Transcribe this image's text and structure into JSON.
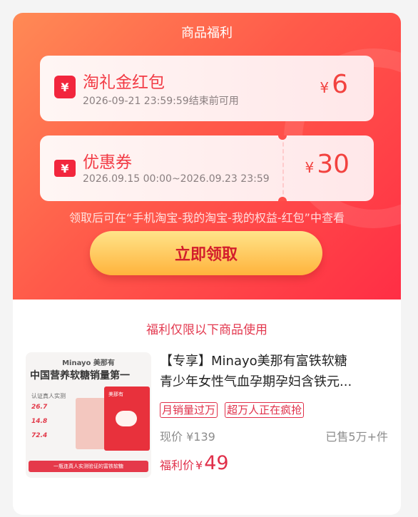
{
  "header": {
    "title": "商品福利"
  },
  "coupons": [
    {
      "icon": "red-envelope-icon",
      "icon_glyph": "¥",
      "title": "淘礼金红包",
      "validity": "2026-09-21 23:59:59结束前可用",
      "currency": "¥",
      "amount": "6"
    },
    {
      "icon": "coupon-ticket-icon",
      "icon_glyph": "¥",
      "title": "优惠券",
      "validity": "2026.09.15 00:00~2026.09.23 23:59",
      "currency": "¥",
      "amount": "30"
    }
  ],
  "hint": "领取后可在“手机淘宝-我的淘宝-我的权益-红包”中查看",
  "claim_button": "立即领取",
  "section_title": "福利仅限以下商品使用",
  "product": {
    "title_line1": "【专享】Minayo美那有富铁软糖",
    "title_line2": "青少年女性气血孕期孕妇含铁元...",
    "tags": [
      "月销量过万",
      "超万人正在疯抢"
    ],
    "price_now_label": "现价",
    "price_now": "¥139",
    "sold": "已售5万+件",
    "benefit_label": "福利价",
    "benefit_currency": "¥",
    "benefit_price": "49",
    "image": {
      "brand": "Minayo 美那有",
      "headline": "中国营养软糖销量第一",
      "sub": "认证真人实测",
      "stats": [
        "26.7",
        "14.8",
        "72.4"
      ],
      "box_label": "美那有",
      "banner": "一瓶连真人实测验证的富铁软糖"
    }
  },
  "colors": {
    "hero_start": "#ff8a55",
    "hero_end": "#ff2e45",
    "accent_red": "#f2263d",
    "button_gold": "#ffc24d",
    "button_text": "#d31d2c"
  }
}
